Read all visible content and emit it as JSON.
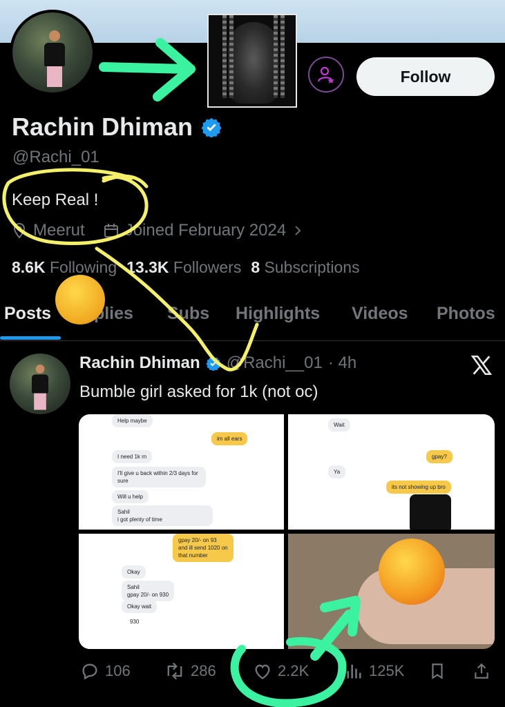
{
  "profile": {
    "name": "Rachin Dhiman",
    "handle": "@Rachi_01",
    "bio": "Keep Real !",
    "location": "Meerut",
    "joined": "Joined February 2024",
    "follow_label": "Follow",
    "stats": {
      "following_count": "8.6K",
      "following_label": "Following",
      "followers_count": "13.3K",
      "followers_label": "Followers",
      "subscriptions_count": "8",
      "subscriptions_label": "Subscriptions"
    }
  },
  "tabs": [
    {
      "label": "Posts"
    },
    {
      "label": "Replies"
    },
    {
      "label": "Subs"
    },
    {
      "label": "Highlights"
    },
    {
      "label": "Videos"
    },
    {
      "label": "Photos"
    }
  ],
  "tweet": {
    "author": "Rachin Dhiman",
    "handle": "@Rachi__01",
    "time": "· 4h",
    "text": "Bumble girl asked for 1k (not oc)",
    "chat1": {
      "m1": "Help maybe",
      "m2": "im all ears",
      "m3": "I need 1k rn",
      "m4": "I'll give u back within 2/3 days for sure",
      "m5": "Will u help",
      "m6": "Sahil\ni got plenty of time"
    },
    "chat2": {
      "m1": "Wait",
      "m2": "gpay?",
      "m3": "Ya",
      "m4": "its not showing up bro"
    },
    "chat3": {
      "m1": "gpay 20/- on 93\nand ill send 1020 on\nthat number",
      "m2": "Okay",
      "m3": "Sahil\ngpay 20/- on 930",
      "m4": "Okay wait",
      "m5": "930"
    },
    "actions": {
      "replies": "106",
      "reposts": "286",
      "likes": "2.2K",
      "views": "125K"
    }
  },
  "colors": {
    "accent": "#1d9bf0",
    "annotation_green": "#3af2a0",
    "annotation_yellow": "#f5f06a",
    "subscribe_purple": "#c13bd6"
  }
}
